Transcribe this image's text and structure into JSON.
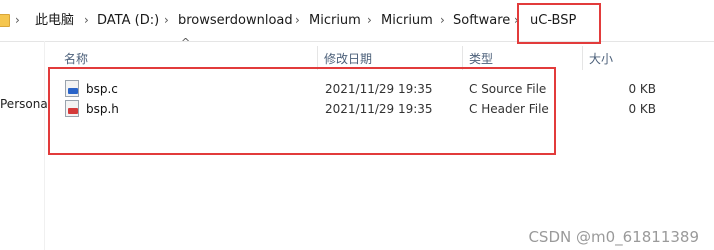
{
  "breadcrumb": [
    "此电脑",
    "DATA (D:)",
    "browserdownload",
    "Micrium",
    "Micrium",
    "Software",
    "uC-BSP"
  ],
  "columns": {
    "name": "名称",
    "modified": "修改日期",
    "type": "类型",
    "size": "大小"
  },
  "nav": {
    "partial_label": "Persona"
  },
  "files": [
    {
      "name": "bsp.c",
      "modified": "2021/11/29 19:35",
      "type": "C Source File",
      "size": "0 KB",
      "icon": "c-source-file-icon",
      "badge_color": "#2a64c8"
    },
    {
      "name": "bsp.h",
      "modified": "2021/11/29 19:35",
      "type": "C Header File",
      "size": "0 KB",
      "icon": "c-header-file-icon",
      "badge_color": "#d43a3a"
    }
  ],
  "highlight_color": "#e23b3b",
  "watermark": "CSDN @m0_61811389"
}
